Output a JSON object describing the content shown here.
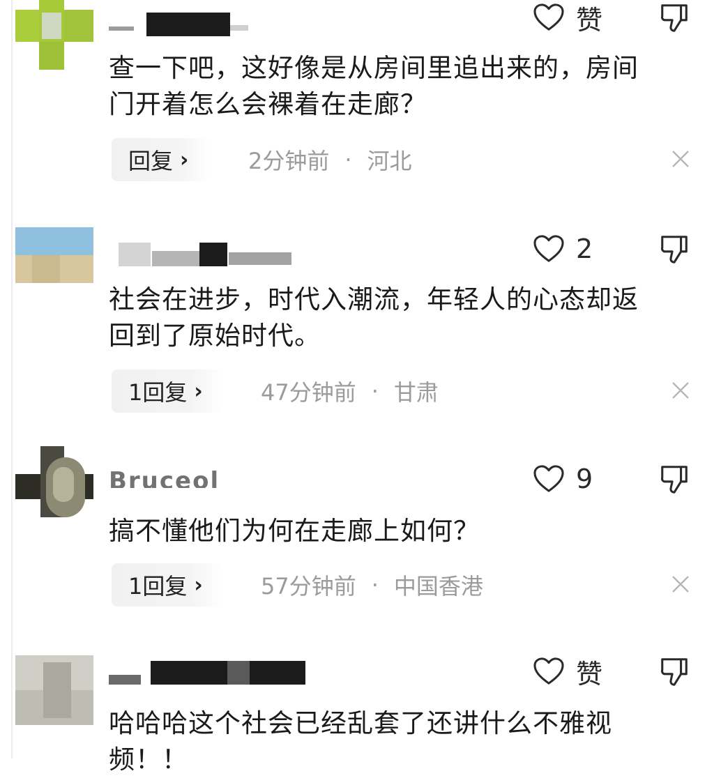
{
  "comments": [
    {
      "username": "",
      "text": "查一下吧，这好像是从房间里追出来的，房间\n门开着怎么会裸着在走廊？",
      "like_label": "赞",
      "reply_label": "回复",
      "time": "2分钟前",
      "location": "河北"
    },
    {
      "username": "",
      "text": "社会在进步，时代入潮流，年轻人的心态却返\n回到了原始时代。",
      "like_label": "2",
      "reply_label": "1回复",
      "time": "47分钟前",
      "location": "甘肃"
    },
    {
      "username": "Bruceol",
      "text": "搞不懂他们为何在走廊上如何？",
      "like_label": "9",
      "reply_label": "1回复",
      "time": "57分钟前",
      "location": "中国香港"
    },
    {
      "username": "",
      "text": "哈哈哈这个社会已经乱套了还讲什么不雅视\n频！！",
      "like_label": "赞",
      "reply_label": "",
      "time": "",
      "location": ""
    }
  ],
  "separator": "·",
  "reply_chevron": "›",
  "icons": {
    "like": "heart-outline-icon",
    "dislike": "thumbs-down-icon",
    "close": "close-icon"
  },
  "colors": {
    "text": "#1a1a1a",
    "meta": "#9b9b9b",
    "pill": "#f2f2f2"
  }
}
